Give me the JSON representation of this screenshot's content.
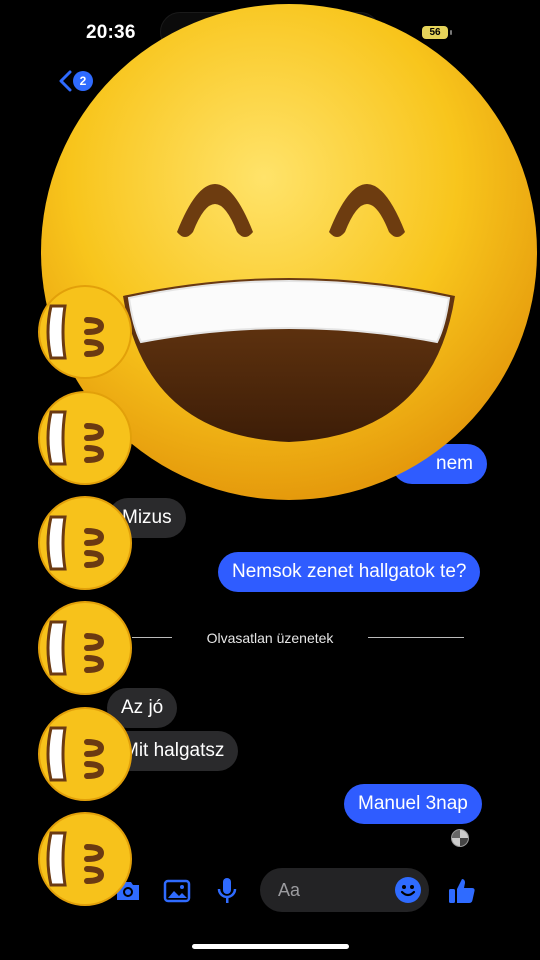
{
  "status_bar": {
    "time": "20:36",
    "battery": "56"
  },
  "header": {
    "back_count": "2"
  },
  "messages": [
    {
      "side": "out",
      "text": "nem"
    },
    {
      "side": "in",
      "text": "Mizus"
    },
    {
      "side": "out",
      "text": "Nemsok zenet hallgatok te?"
    },
    {
      "side": "in",
      "text": "Az jó"
    },
    {
      "side": "in",
      "text": "Mit halgatsz"
    },
    {
      "side": "out",
      "text": "Manuel 3nap"
    }
  ],
  "divider": {
    "text": "Olvasatlan üzenetek"
  },
  "composer": {
    "placeholder": "Aa"
  },
  "colors": {
    "accent": "#2f5cff",
    "incoming_bubble": "#2a2a2c",
    "emoji_yellow": "#f7c21b"
  }
}
